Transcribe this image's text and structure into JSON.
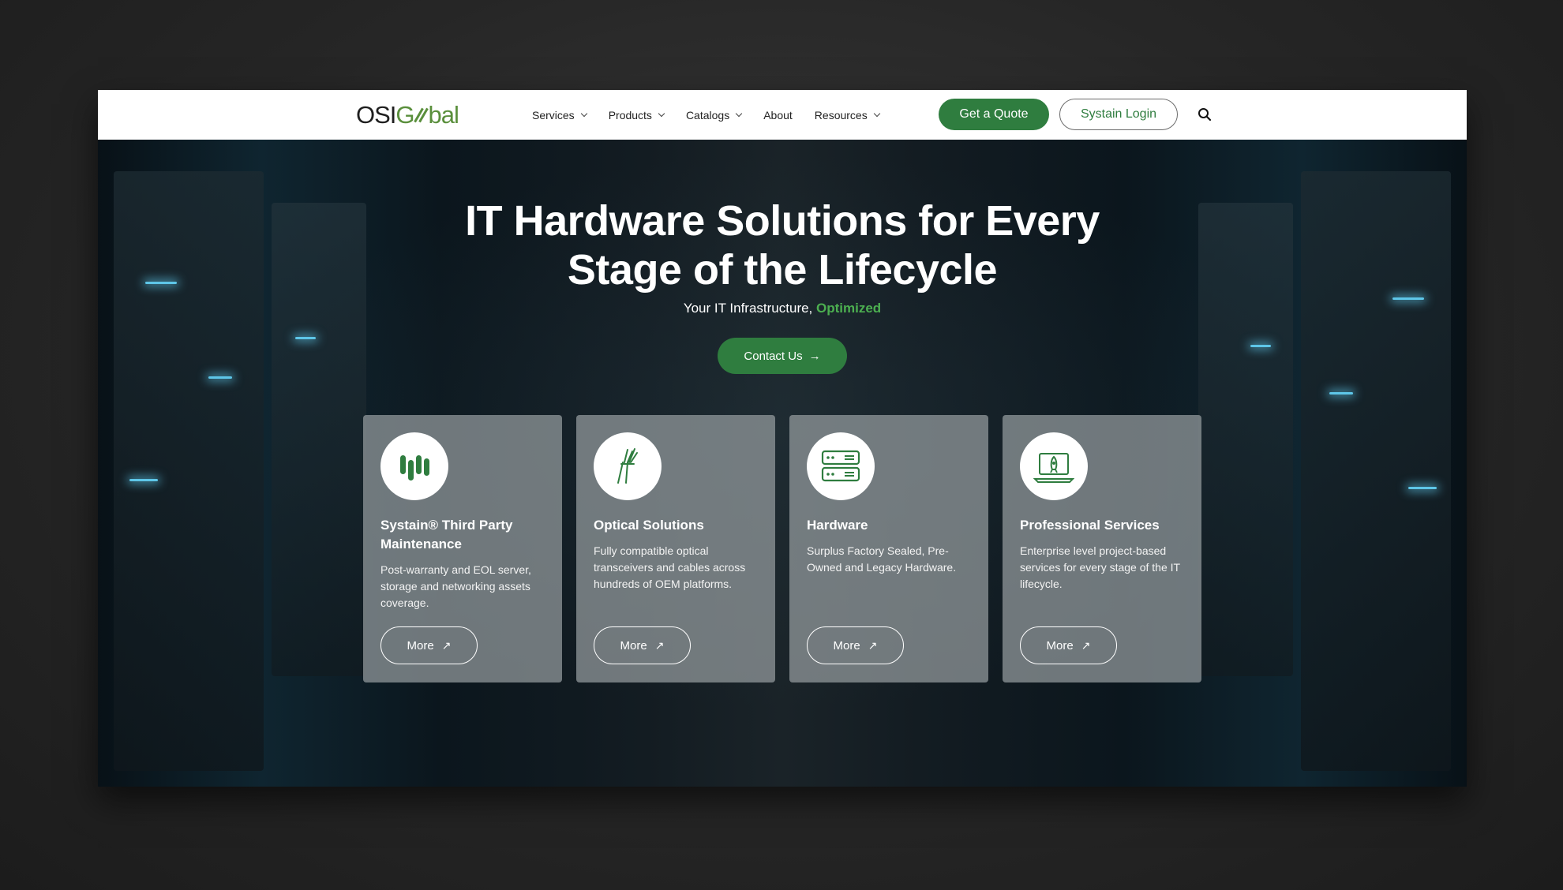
{
  "header": {
    "logo_text_osi": "OSI",
    "logo_text_global": "Glbal",
    "nav": [
      {
        "label": "Services",
        "has_dropdown": true
      },
      {
        "label": "Products",
        "has_dropdown": true
      },
      {
        "label": "Catalogs",
        "has_dropdown": true
      },
      {
        "label": "About",
        "has_dropdown": false
      },
      {
        "label": "Resources",
        "has_dropdown": true
      }
    ],
    "quote_label": "Get a Quote",
    "login_label": "Systain Login",
    "search_icon": "search-icon"
  },
  "hero": {
    "title_line1": "IT Hardware Solutions for Every",
    "title_line2": "Stage of the Lifecycle",
    "subtitle_prefix": "Your IT Infrastructure, ",
    "subtitle_accent": "Optimized",
    "contact_label": "Contact Us",
    "contact_icon": "arrow-right-icon"
  },
  "cards": [
    {
      "icon": "maintenance-bars-icon",
      "title": "Systain® Third Party Maintenance",
      "description": "Post-warranty and EOL server, storage and networking assets coverage.",
      "more_label": "More"
    },
    {
      "icon": "fiber-optic-icon",
      "title": "Optical Solutions",
      "description": "Fully compatible optical transceivers and cables across hundreds of OEM platforms.",
      "more_label": "More"
    },
    {
      "icon": "server-icon",
      "title": "Hardware",
      "description": "Surplus Factory Sealed, Pre-Owned and Legacy Hardware.",
      "more_label": "More"
    },
    {
      "icon": "rocket-laptop-icon",
      "title": "Professional Services",
      "description": "Enterprise level project-based services for every stage of the IT lifecycle.",
      "more_label": "More"
    }
  ],
  "colors": {
    "brand_green": "#2f7d3f",
    "accent_green": "#4caf50",
    "header_bg": "#ffffff"
  },
  "floating": {
    "chat_icon": "chat-check-icon"
  }
}
